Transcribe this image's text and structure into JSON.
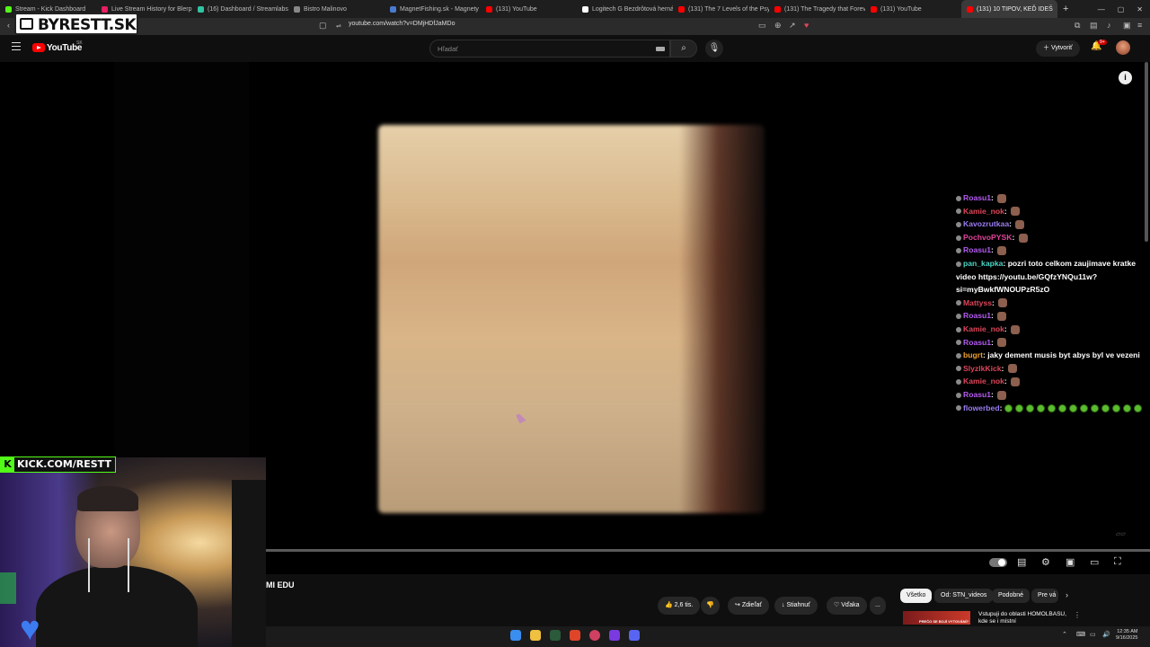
{
  "browser": {
    "tabs": [
      {
        "label": "Stream - Kick Dashboard",
        "favicon_color": "#53fc18"
      },
      {
        "label": "Live Stream History for Blerp S",
        "favicon_color": "#e91e63"
      },
      {
        "label": "(16) Dashboard / Streamlabs",
        "favicon_color": "#31c3a2"
      },
      {
        "label": "Bistro Malinovo",
        "favicon_color": "#888888"
      },
      {
        "label": "MagnetFishing.sk - Magnety a",
        "favicon_color": "#4a7bd0"
      },
      {
        "label": "(131) YouTube",
        "favicon_color": "#ff0000"
      },
      {
        "label": "Logitech G Bezdrôtová herná m",
        "favicon_color": "#ffffff"
      },
      {
        "label": "(131) The 7 Levels of the Psych",
        "favicon_color": "#ff0000"
      },
      {
        "label": "(131) The Tragedy that Forever",
        "favicon_color": "#ff0000"
      },
      {
        "label": "(131) YouTube",
        "favicon_color": "#ff0000"
      },
      {
        "label": "(131) 10 TIPOV, KEĎ IDEŠ",
        "favicon_color": "#ff0000",
        "active": true
      }
    ],
    "url": "youtube.com/watch?v=DMjHDfJaMDo"
  },
  "header": {
    "logo_text": "YouTube",
    "country_code": "SK",
    "search_placeholder": "Hľadať",
    "create_label": "Vytvoriť",
    "notifications_badge": "9+"
  },
  "overlay": {
    "site_logo": "BYRESTT.SK",
    "kick_url": "KICK.COM/RESTT"
  },
  "chat": [
    {
      "user": "Roasu1",
      "color": "#b45cf0",
      "text": "",
      "emote": true
    },
    {
      "user": "Kamie_nok",
      "color": "#e0455a",
      "text": "",
      "emote": true
    },
    {
      "user": "Kavozrutkaa",
      "color": "#9a7cf0",
      "text": "",
      "emote": true
    },
    {
      "user": "PochvoPYSK",
      "color": "#e0459a",
      "text": "",
      "emote": true
    },
    {
      "user": "Roasu1",
      "color": "#b45cf0",
      "text": "",
      "emote": true
    },
    {
      "user": "pan_kapka",
      "color": "#4ad6c6",
      "text": "pozri toto celkom zaujimave kratke video https://youtu.be/GQfzYNQu11w?si=myBwkfWNOUPzR5zO",
      "emote": false
    },
    {
      "user": "Mattyss",
      "color": "#e0455a",
      "text": "",
      "emote": true
    },
    {
      "user": "Roasu1",
      "color": "#b45cf0",
      "text": "",
      "emote": true
    },
    {
      "user": "Kamie_nok",
      "color": "#e0455a",
      "text": "",
      "emote": true
    },
    {
      "user": "Roasu1",
      "color": "#b45cf0",
      "text": "",
      "emote": true
    },
    {
      "user": "bugrt",
      "color": "#f0a030",
      "text": "jaky dement musis byt abys byl ve vezeni",
      "emote": false
    },
    {
      "user": "SlyzlkKick",
      "color": "#e0455a",
      "text": "",
      "emote": true
    },
    {
      "user": "Kamie_nok",
      "color": "#e0455a",
      "text": "",
      "emote": true
    },
    {
      "user": "Roasu1",
      "color": "#b45cf0",
      "text": "",
      "emote": true
    },
    {
      "user": "flowerbed",
      "color": "#9a7cf0",
      "text": "",
      "emote": false,
      "green_emotes": 13
    }
  ],
  "video": {
    "title": "MI EDU",
    "likes": "2,6 tis.",
    "share_label": "Zdieľať",
    "download_label": "Stiahnuť",
    "thanks_label": "Vďaka",
    "more_label": "...",
    "progress": 0
  },
  "chips": [
    {
      "label": "Všetko",
      "selected": true
    },
    {
      "label": "Od: STN_videos",
      "selected": false
    },
    {
      "label": "Podobné",
      "selected": false
    },
    {
      "label": "Pre vá",
      "selected": false
    }
  ],
  "recommendation": {
    "thumb_text": "PREČO SE BOJÍ VYTOVÁNÍ?",
    "title": "Vstupuji do oblasti HOMOLBASU, kde se i místní"
  },
  "taskbar": {
    "time": "12:35 AM",
    "date": "9/16/2025"
  }
}
